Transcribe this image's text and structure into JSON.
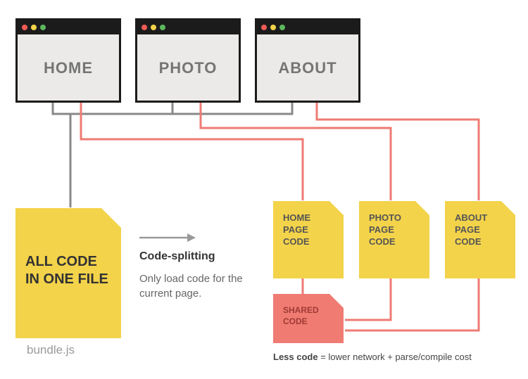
{
  "browsers": {
    "home": "HOME",
    "photo": "PHOTO",
    "about": "ABOUT"
  },
  "bundle": {
    "text": "ALL CODE IN ONE FILE",
    "label": "bundle.js"
  },
  "middle": {
    "heading": "Code-splitting",
    "sub": "Only load code for the current page."
  },
  "chunks": {
    "home": "HOME PAGE CODE",
    "photo": "PHOTO PAGE CODE",
    "about": "ABOUT PAGE CODE",
    "shared": "SHARED CODE"
  },
  "footnote": {
    "bold": "Less code",
    "rest": " = lower network + parse/compile cost"
  }
}
